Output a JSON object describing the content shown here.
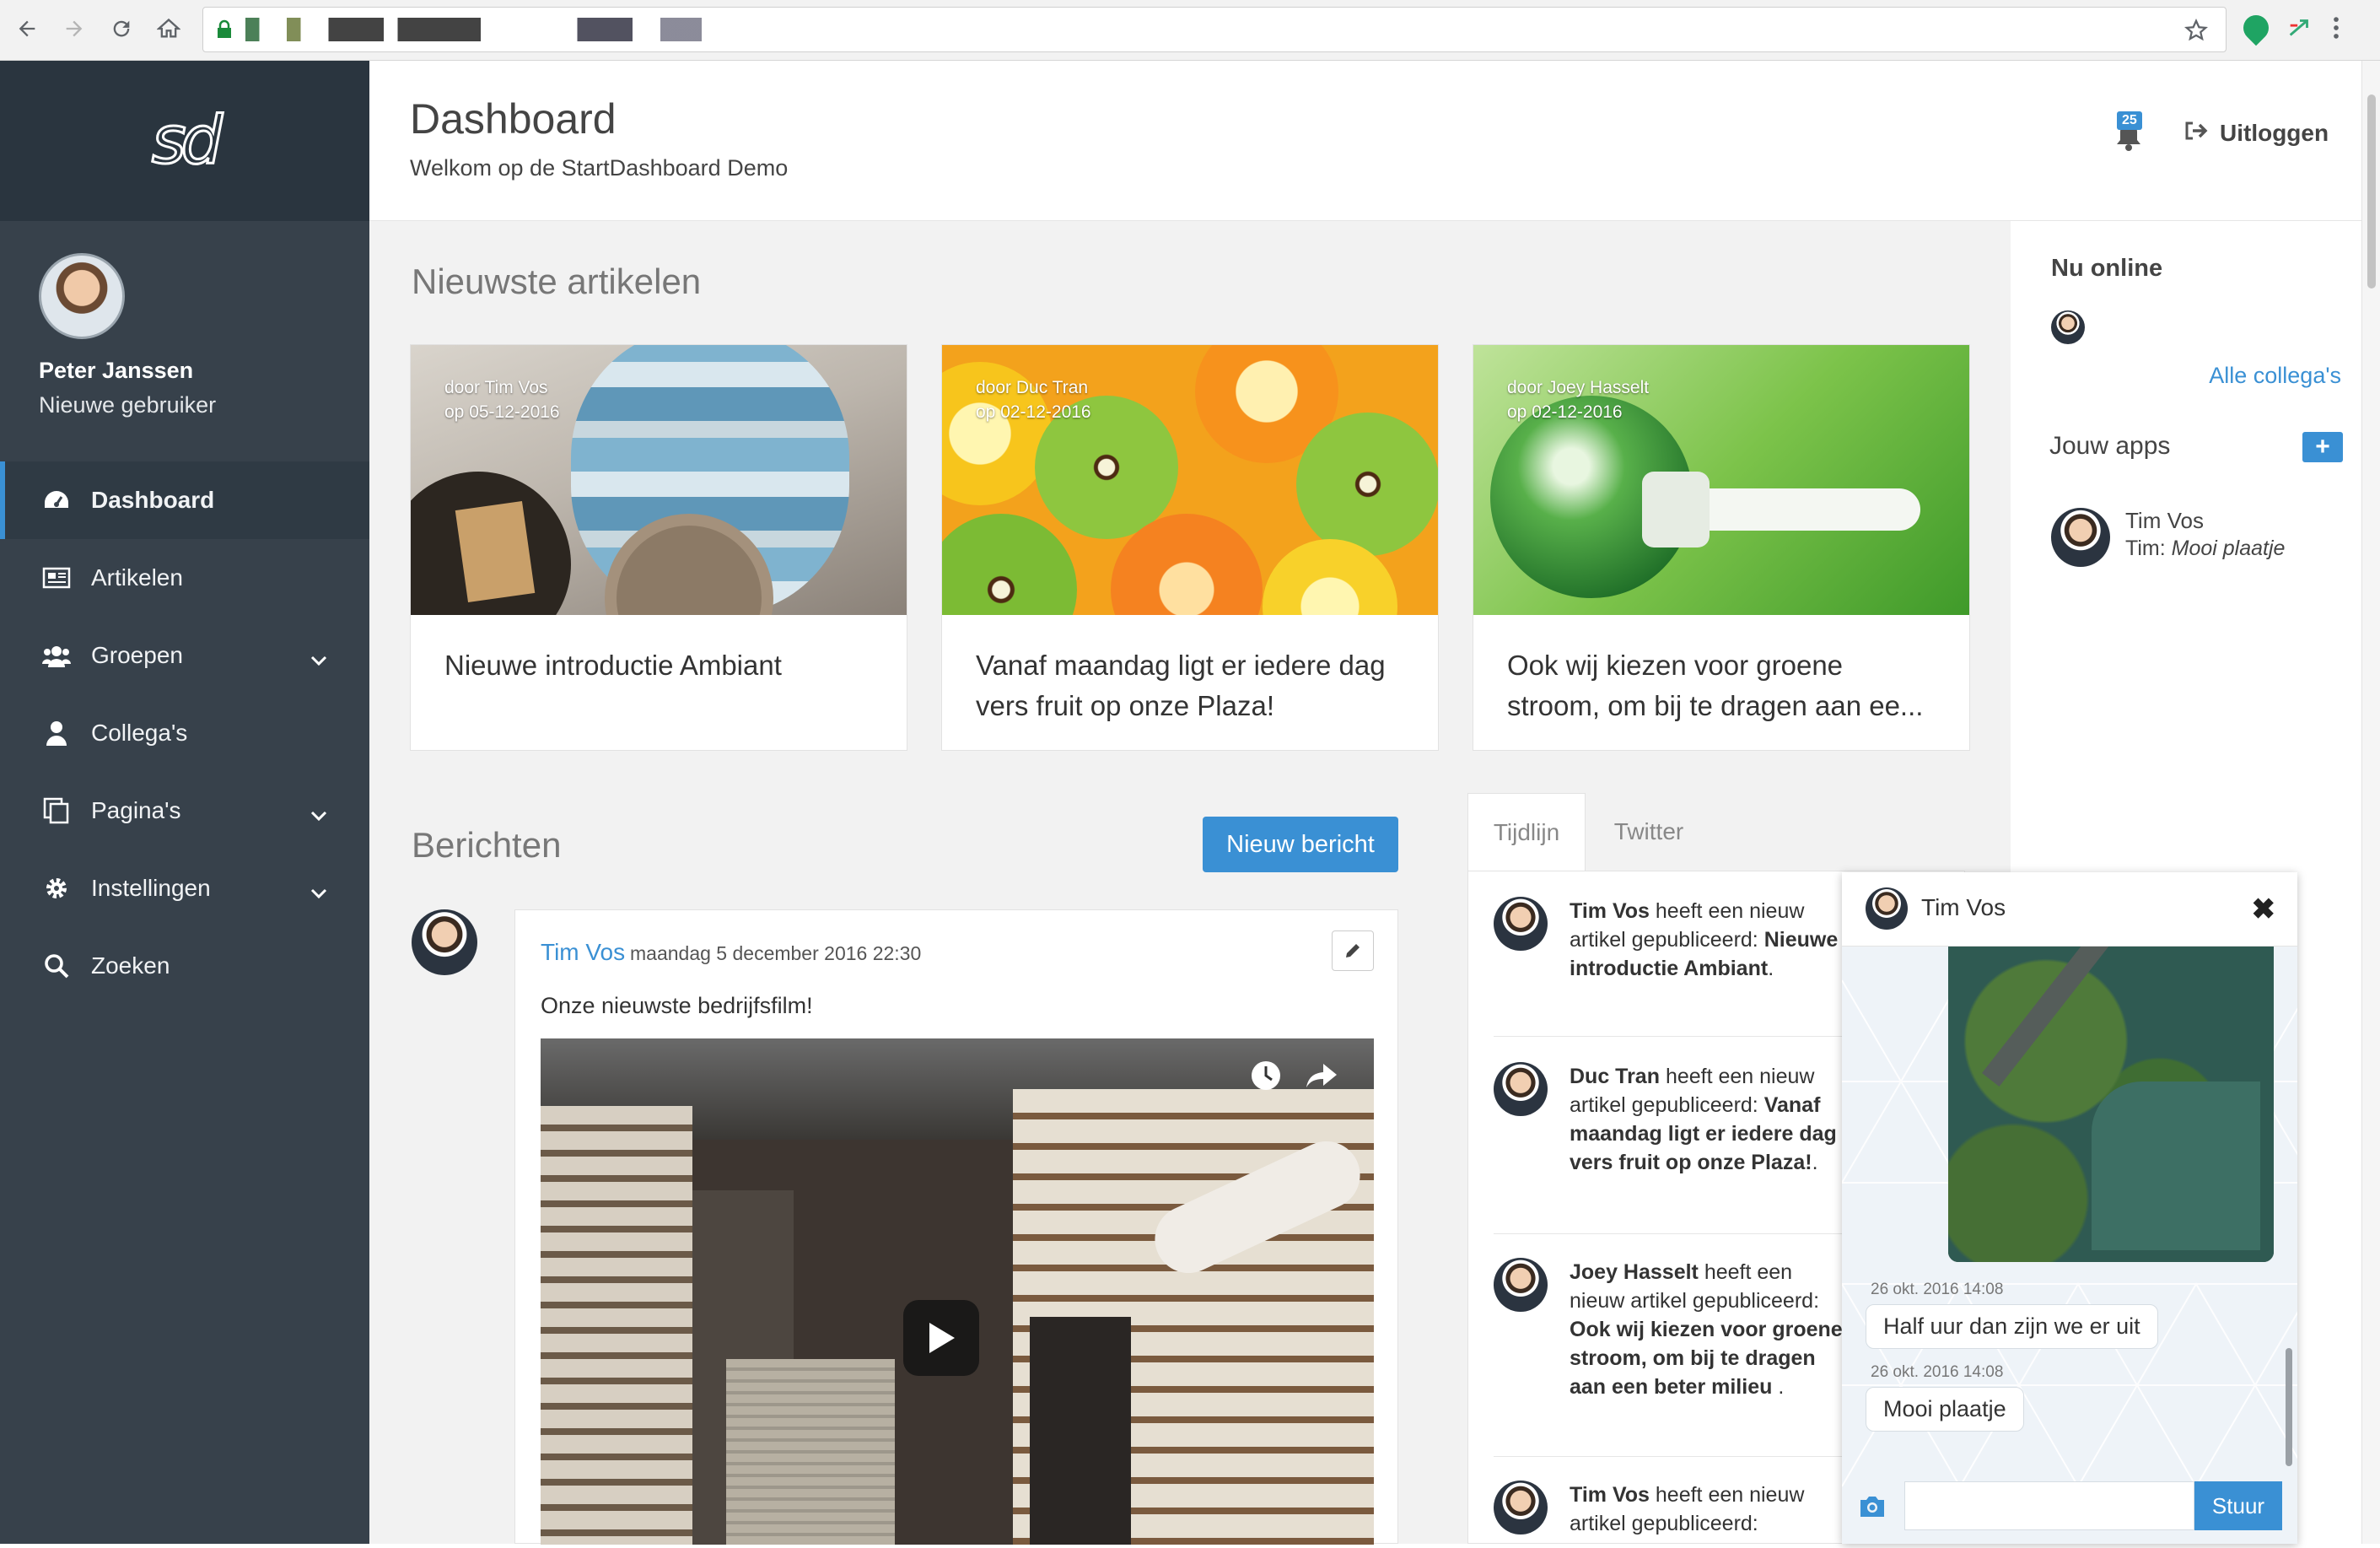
{
  "browser": {
    "back_icon": "back-arrow-icon",
    "forward_icon": "forward-arrow-icon",
    "reload_icon": "reload-icon",
    "home_icon": "home-icon",
    "star_icon": "star-icon"
  },
  "brand": {
    "logo": "sd"
  },
  "profile": {
    "name": "Peter Janssen",
    "role": "Nieuwe gebruiker"
  },
  "sidebar": {
    "items": [
      {
        "label": "Dashboard",
        "icon": "dashboard-icon",
        "active": true
      },
      {
        "label": "Artikelen",
        "icon": "newspaper-icon"
      },
      {
        "label": "Groepen",
        "icon": "users-icon",
        "dropdown": true
      },
      {
        "label": "Collega's",
        "icon": "user-icon"
      },
      {
        "label": "Pagina's",
        "icon": "pages-icon",
        "dropdown": true
      },
      {
        "label": "Instellingen",
        "icon": "gear-icon",
        "dropdown": true
      },
      {
        "label": "Zoeken",
        "icon": "search-icon"
      }
    ]
  },
  "header": {
    "title": "Dashboard",
    "subtitle": "Welkom op de StartDashboard Demo",
    "notification_count": "25",
    "logout_label": "Uitloggen"
  },
  "articles": {
    "heading": "Nieuwste artikelen",
    "items": [
      {
        "author": "door Tim Vos",
        "date": "op 05-12-2016",
        "title": "Nieuwe introductie Ambiant"
      },
      {
        "author": "door Duc Tran",
        "date": "op 02-12-2016",
        "title": "Vanaf maandag ligt er iedere dag vers fruit op onze Plaza!"
      },
      {
        "author": "door Joey Hasselt",
        "date": "op 02-12-2016",
        "title": "Ook wij kiezen voor groene stroom, om bij te dragen aan ee..."
      }
    ]
  },
  "berichten": {
    "heading": "Berichten",
    "new_button": "Nieuw bericht",
    "post": {
      "author": "Tim Vos",
      "date": "maandag 5 december 2016 22:30",
      "text": "Onze nieuwste bedrijfsfilm!"
    }
  },
  "timeline": {
    "tabs": [
      "Tijdlijn",
      "Twitter"
    ],
    "items": [
      {
        "name": "Tim Vos",
        "action": "heeft een nieuw artikel gepubliceerd:",
        "article": "Nieuwe introductie Ambiant",
        "end": "."
      },
      {
        "name": "Duc Tran",
        "action": "heeft een nieuw artikel gepubliceerd:",
        "article": "Vanaf maandag ligt er iedere dag vers fruit op onze Plaza!",
        "end": "."
      },
      {
        "name": "Joey Hasselt",
        "action": "heeft een nieuw artikel gepubliceerd:",
        "article": "Ook wij kiezen voor groene stroom, om bij te dragen aan een beter milieu",
        "end": " ."
      },
      {
        "name": "Tim Vos",
        "action": "heeft een nieuw artikel gepubliceerd:",
        "article": "",
        "end": ""
      }
    ]
  },
  "right": {
    "online_heading": "Nu online",
    "all_colleagues": "Alle collega's",
    "apps_heading": "Jouw apps",
    "apps_add": "+",
    "chat_preview": {
      "name": "Tim Vos",
      "prefix": "Tim:",
      "message": "Mooi plaatje"
    }
  },
  "chat": {
    "name": "Tim Vos",
    "messages": [
      {
        "time": "26 okt. 2016 14:08",
        "text": "Half uur dan zijn we er uit"
      },
      {
        "time": "26 okt. 2016 14:08",
        "text": "Mooi plaatje"
      }
    ],
    "input_placeholder": "",
    "send_label": "Stuur"
  },
  "colors": {
    "accent": "#3a90d4",
    "sidebar": "#37414b",
    "sidebar_dark": "#2a353f"
  }
}
